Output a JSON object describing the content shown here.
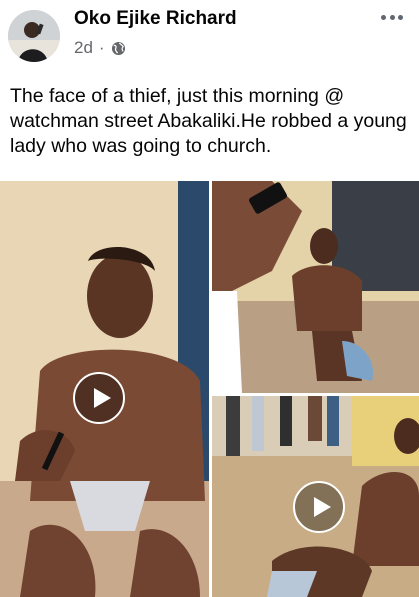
{
  "post": {
    "author": "Oko Ejike Richard",
    "timestamp": "2d",
    "separator": "·",
    "privacy_icon": "globe-icon",
    "more_icon": "more-options-icon",
    "text": "The face of a thief, just this morning @ watchman street Abakaliki.He robbed a young lady who was going to church."
  },
  "media": {
    "items": [
      {
        "kind": "video",
        "icon": "play-icon"
      },
      {
        "kind": "photo"
      },
      {
        "kind": "video",
        "icon": "play-icon"
      }
    ]
  }
}
